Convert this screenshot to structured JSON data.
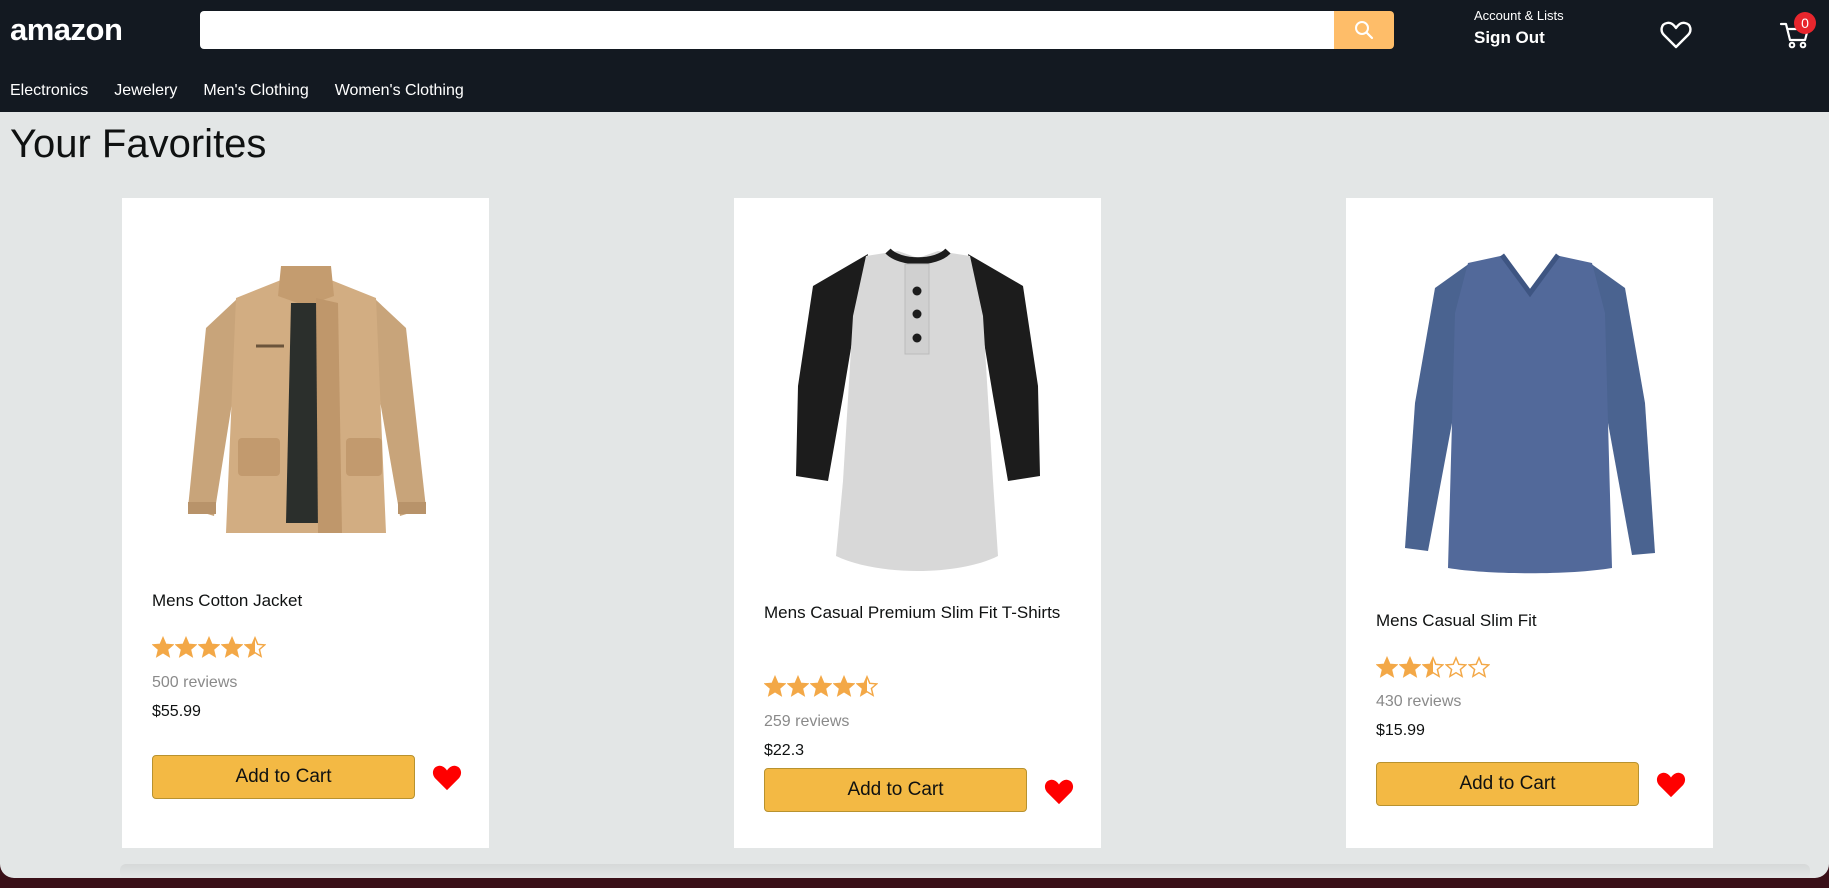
{
  "header": {
    "logo": "amazon",
    "search_placeholder": "",
    "account_top": "Account & Lists",
    "account_bottom": "Sign Out",
    "cart_count": "0",
    "icons": {
      "search": "search-icon",
      "wishlist": "heart-outline-icon",
      "cart": "cart-icon"
    }
  },
  "nav": {
    "items": [
      "Electronics",
      "Jewelery",
      "Men's Clothing",
      "Women's Clothing"
    ]
  },
  "page": {
    "title": "Your Favorites"
  },
  "products": [
    {
      "name": "Mens Cotton Jacket",
      "rating": 4.5,
      "reviews": "500 reviews",
      "price": "$55.99",
      "button": "Add to Cart",
      "favorite": true
    },
    {
      "name": "Mens Casual Premium Slim Fit T-Shirts",
      "rating": 4.5,
      "reviews": "259 reviews",
      "price": "$22.3",
      "button": "Add to Cart",
      "favorite": true
    },
    {
      "name": "Mens Casual Slim Fit",
      "rating": 2.5,
      "reviews": "430 reviews",
      "price": "$15.99",
      "button": "Add to Cart",
      "favorite": true
    }
  ],
  "colors": {
    "header_bg": "#131921",
    "search_button": "#febd69",
    "star": "#f3a847",
    "add_button": "#f3b944",
    "heart": "#ff0000",
    "badge": "#e8262d"
  }
}
